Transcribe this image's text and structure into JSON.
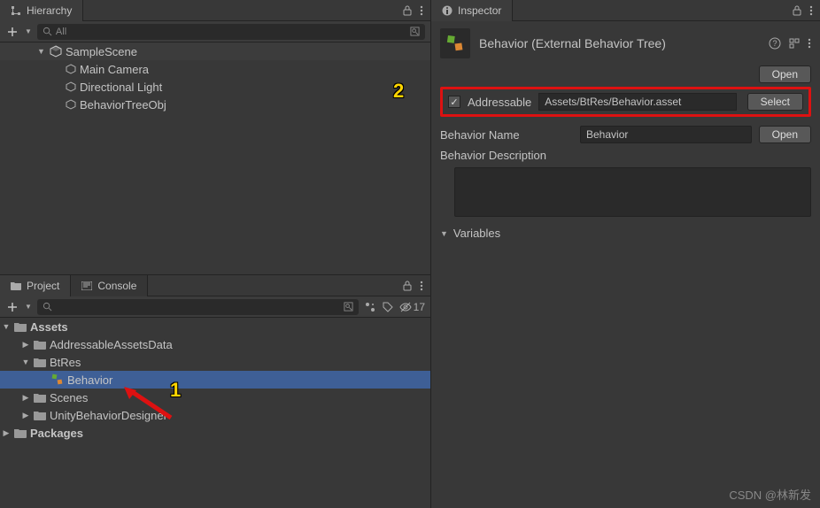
{
  "hierarchy": {
    "tab_label": "Hierarchy",
    "search_placeholder": "All",
    "scene": "SampleScene",
    "objects": [
      "Main Camera",
      "Directional Light",
      "BehaviorTreeObj"
    ]
  },
  "project": {
    "tab_label": "Project",
    "console_tab": "Console",
    "hidden_count": "17",
    "tree": {
      "assets": "Assets",
      "addressable": "AddressableAssetsData",
      "btres": "BtRes",
      "behavior": "Behavior",
      "scenes": "Scenes",
      "ubd": "UnityBehaviorDesigner",
      "packages": "Packages"
    }
  },
  "inspector": {
    "tab_label": "Inspector",
    "asset_title": "Behavior (External Behavior Tree)",
    "open_btn": "Open",
    "addressable_label": "Addressable",
    "addressable_path": "Assets/BtRes/Behavior.asset",
    "select_btn": "Select",
    "behavior_name_label": "Behavior Name",
    "behavior_name_value": "Behavior",
    "behavior_desc_label": "Behavior Description",
    "variables_label": "Variables"
  },
  "callouts": {
    "one": "1",
    "two": "2"
  },
  "watermark": "CSDN @林新发"
}
